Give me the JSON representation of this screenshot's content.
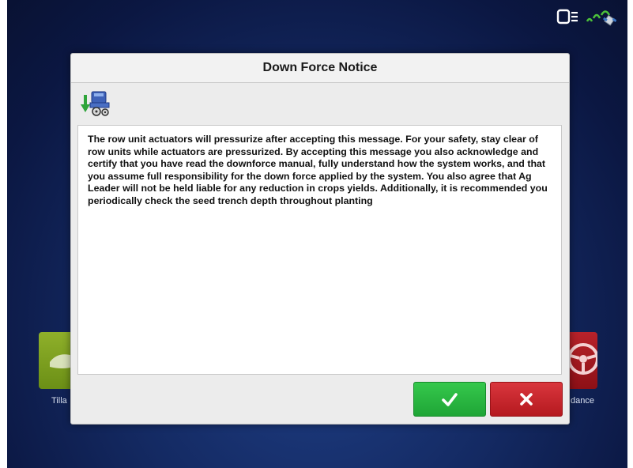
{
  "dialog": {
    "title": "Down Force Notice",
    "message": "The row unit actuators will pressurize after accepting this message. For your safety, stay clear of row units while actuators are pressurized. By accepting this message you also acknowledge and certify that you have read the downforce manual, fully understand how the system works, and that you assume full responsibility for the down force applied by the system. You also agree that Ag Leader will not be held liable for any reduction in crops yields. Additionally, it is recommended you periodically check the seed trench depth throughout planting",
    "icon": "planter-downforce-icon",
    "accept_icon": "checkmark-icon",
    "reject_icon": "x-icon"
  },
  "status_bar": {
    "icons": [
      "display-monitor-icon",
      "gps-signal-icon"
    ]
  },
  "background": {
    "left_tile_label": "Tilla",
    "right_tile_label": "dance"
  },
  "colors": {
    "accept": "#2bbb42",
    "reject": "#c8262c",
    "background": "#142a63"
  }
}
